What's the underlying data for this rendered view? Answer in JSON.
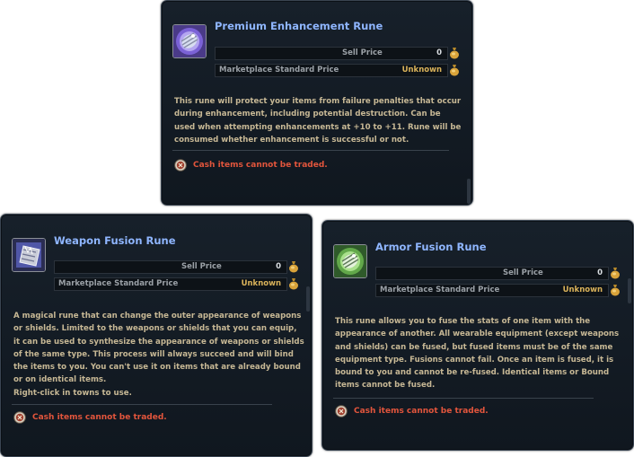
{
  "tooltips": [
    {
      "title": "Premium Enhancement Rune",
      "icon": "premium-enhancement-rune-icon",
      "sell_price_label": "Sell Price",
      "sell_price_value": "0",
      "market_label": "Marketplace Standard Price",
      "market_value": "Unknown",
      "description": [
        "This rune will protect your items from failure penalties that occur",
        "during enhancement, including potential destruction. Can be",
        "used when attempting enhancements at +10 to +11. Rune will be",
        "consumed whether enhancement is successful or not."
      ],
      "warning": "Cash items cannot be traded."
    },
    {
      "title": "Weapon Fusion Rune",
      "icon": "weapon-fusion-rune-icon",
      "sell_price_label": "Sell Price",
      "sell_price_value": "0",
      "market_label": "Marketplace Standard Price",
      "market_value": "Unknown",
      "description": [
        "A magical rune that can change the outer appearance of weapons",
        "or shields. Limited to the weapons or shields that you can equip,",
        "it can be used to synthesize the appearance of weapons or shields",
        "of the same type. This process will always succeed and will bind",
        "the items to you. You can't use it on items that are already bound",
        "or on identical items.",
        "Right-click in towns to use."
      ],
      "warning": "Cash items cannot be traded."
    },
    {
      "title": "Armor Fusion Rune",
      "icon": "armor-fusion-rune-icon",
      "sell_price_label": "Sell Price",
      "sell_price_value": "0",
      "market_label": "Marketplace Standard Price",
      "market_value": "Unknown",
      "description": [
        "This rune allows you to fuse the stats of one item with the",
        "appearance of another. All wearable equipment (except weapons",
        "and shields) can be fused, but fused items must be of the same",
        "equipment type. Fusions cannot fail. Once an item is fused, it is",
        "bound to you and cannot be re-fused. Identical items or Bound",
        "items cannot be fused."
      ],
      "warning": "Cash items cannot be traded."
    }
  ],
  "colors": {
    "title": "#8fb6ff",
    "description": "#c7b895",
    "warning": "#e2553c",
    "unknown": "#d9b25a",
    "panel_bg": "#141c25"
  }
}
